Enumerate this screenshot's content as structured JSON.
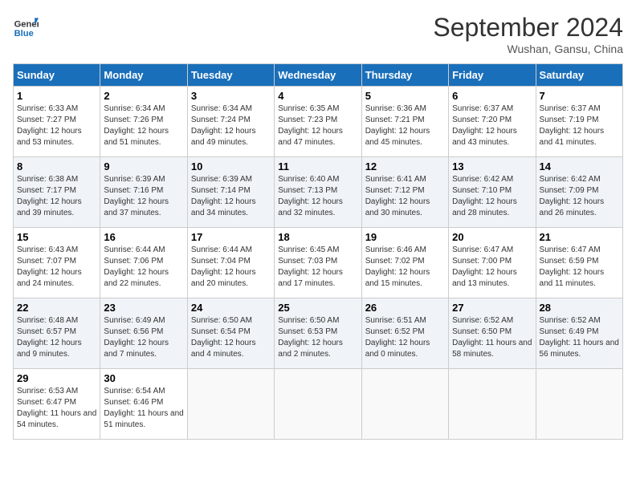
{
  "header": {
    "logo_line1": "General",
    "logo_line2": "Blue",
    "month": "September 2024",
    "location": "Wushan, Gansu, China"
  },
  "weekdays": [
    "Sunday",
    "Monday",
    "Tuesday",
    "Wednesday",
    "Thursday",
    "Friday",
    "Saturday"
  ],
  "weeks": [
    [
      {
        "day": "1",
        "sunrise": "6:33 AM",
        "sunset": "7:27 PM",
        "daylight": "12 hours and 53 minutes."
      },
      {
        "day": "2",
        "sunrise": "6:34 AM",
        "sunset": "7:26 PM",
        "daylight": "12 hours and 51 minutes."
      },
      {
        "day": "3",
        "sunrise": "6:34 AM",
        "sunset": "7:24 PM",
        "daylight": "12 hours and 49 minutes."
      },
      {
        "day": "4",
        "sunrise": "6:35 AM",
        "sunset": "7:23 PM",
        "daylight": "12 hours and 47 minutes."
      },
      {
        "day": "5",
        "sunrise": "6:36 AM",
        "sunset": "7:21 PM",
        "daylight": "12 hours and 45 minutes."
      },
      {
        "day": "6",
        "sunrise": "6:37 AM",
        "sunset": "7:20 PM",
        "daylight": "12 hours and 43 minutes."
      },
      {
        "day": "7",
        "sunrise": "6:37 AM",
        "sunset": "7:19 PM",
        "daylight": "12 hours and 41 minutes."
      }
    ],
    [
      {
        "day": "8",
        "sunrise": "6:38 AM",
        "sunset": "7:17 PM",
        "daylight": "12 hours and 39 minutes."
      },
      {
        "day": "9",
        "sunrise": "6:39 AM",
        "sunset": "7:16 PM",
        "daylight": "12 hours and 37 minutes."
      },
      {
        "day": "10",
        "sunrise": "6:39 AM",
        "sunset": "7:14 PM",
        "daylight": "12 hours and 34 minutes."
      },
      {
        "day": "11",
        "sunrise": "6:40 AM",
        "sunset": "7:13 PM",
        "daylight": "12 hours and 32 minutes."
      },
      {
        "day": "12",
        "sunrise": "6:41 AM",
        "sunset": "7:12 PM",
        "daylight": "12 hours and 30 minutes."
      },
      {
        "day": "13",
        "sunrise": "6:42 AM",
        "sunset": "7:10 PM",
        "daylight": "12 hours and 28 minutes."
      },
      {
        "day": "14",
        "sunrise": "6:42 AM",
        "sunset": "7:09 PM",
        "daylight": "12 hours and 26 minutes."
      }
    ],
    [
      {
        "day": "15",
        "sunrise": "6:43 AM",
        "sunset": "7:07 PM",
        "daylight": "12 hours and 24 minutes."
      },
      {
        "day": "16",
        "sunrise": "6:44 AM",
        "sunset": "7:06 PM",
        "daylight": "12 hours and 22 minutes."
      },
      {
        "day": "17",
        "sunrise": "6:44 AM",
        "sunset": "7:04 PM",
        "daylight": "12 hours and 20 minutes."
      },
      {
        "day": "18",
        "sunrise": "6:45 AM",
        "sunset": "7:03 PM",
        "daylight": "12 hours and 17 minutes."
      },
      {
        "day": "19",
        "sunrise": "6:46 AM",
        "sunset": "7:02 PM",
        "daylight": "12 hours and 15 minutes."
      },
      {
        "day": "20",
        "sunrise": "6:47 AM",
        "sunset": "7:00 PM",
        "daylight": "12 hours and 13 minutes."
      },
      {
        "day": "21",
        "sunrise": "6:47 AM",
        "sunset": "6:59 PM",
        "daylight": "12 hours and 11 minutes."
      }
    ],
    [
      {
        "day": "22",
        "sunrise": "6:48 AM",
        "sunset": "6:57 PM",
        "daylight": "12 hours and 9 minutes."
      },
      {
        "day": "23",
        "sunrise": "6:49 AM",
        "sunset": "6:56 PM",
        "daylight": "12 hours and 7 minutes."
      },
      {
        "day": "24",
        "sunrise": "6:50 AM",
        "sunset": "6:54 PM",
        "daylight": "12 hours and 4 minutes."
      },
      {
        "day": "25",
        "sunrise": "6:50 AM",
        "sunset": "6:53 PM",
        "daylight": "12 hours and 2 minutes."
      },
      {
        "day": "26",
        "sunrise": "6:51 AM",
        "sunset": "6:52 PM",
        "daylight": "12 hours and 0 minutes."
      },
      {
        "day": "27",
        "sunrise": "6:52 AM",
        "sunset": "6:50 PM",
        "daylight": "11 hours and 58 minutes."
      },
      {
        "day": "28",
        "sunrise": "6:52 AM",
        "sunset": "6:49 PM",
        "daylight": "11 hours and 56 minutes."
      }
    ],
    [
      {
        "day": "29",
        "sunrise": "6:53 AM",
        "sunset": "6:47 PM",
        "daylight": "11 hours and 54 minutes."
      },
      {
        "day": "30",
        "sunrise": "6:54 AM",
        "sunset": "6:46 PM",
        "daylight": "11 hours and 51 minutes."
      },
      null,
      null,
      null,
      null,
      null
    ]
  ]
}
